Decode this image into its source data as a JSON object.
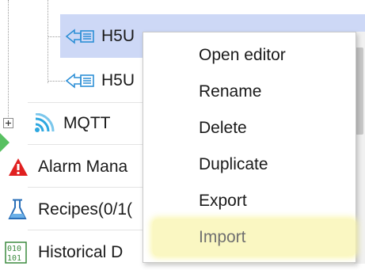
{
  "tree": {
    "items": [
      {
        "label": "H5U",
        "icon": "h5u-device-icon"
      },
      {
        "label": "H5U",
        "icon": "h5u-device-icon"
      },
      {
        "label": "MQTT",
        "icon": "wireless-signal-icon"
      },
      {
        "label": "Alarm Mana",
        "icon": "alarm-warning-icon"
      },
      {
        "label": "Recipes(0/1(",
        "icon": "flask-icon"
      },
      {
        "label": "Historical D",
        "icon": "binary-data-icon"
      }
    ]
  },
  "context_menu": {
    "items": [
      "Open editor",
      "Rename",
      "Delete",
      "Duplicate",
      "Export",
      "Import"
    ],
    "highlighted": "Import"
  },
  "colors": {
    "selection": "#cdd8f6",
    "highlight": "#faf7c2",
    "mqtt_icon": "#2da7e0",
    "alarm_icon": "#e02020",
    "h5u_icon": "#2d8fd6"
  }
}
